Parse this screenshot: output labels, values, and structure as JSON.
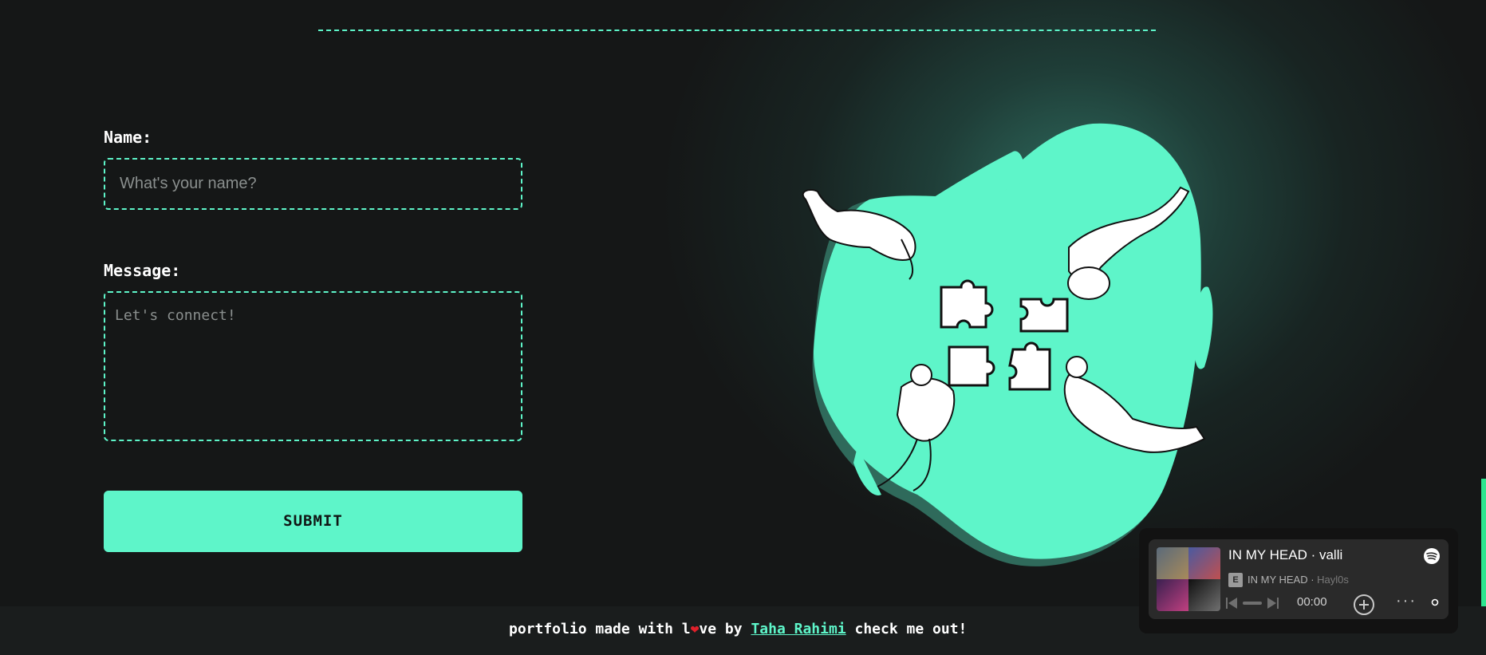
{
  "form": {
    "name_label": "Name:",
    "name_placeholder": "What's your name?",
    "message_label": "Message:",
    "message_placeholder": "Let's connect!",
    "submit_label": "SUBMIT"
  },
  "footer": {
    "text_before": "portfolio made with l",
    "heart": "❤",
    "text_after_heart": "ve by ",
    "author_link": "Taha Rahimi",
    "text_end": " check me out!"
  },
  "player": {
    "title": "IN MY HEAD · valli",
    "explicit_badge": "E",
    "album": "IN MY HEAD",
    "separator": " · ",
    "artist": "Hayl0s",
    "time": "00:00",
    "more": "···"
  },
  "colors": {
    "accent": "#5ef5c9",
    "background": "#151717",
    "heart": "#e0202a",
    "player_bg": "#2a2a2a",
    "spotify_green": "#ffffff"
  },
  "icons": [
    "spotify-icon",
    "previous-icon",
    "next-icon",
    "add-icon",
    "more-icon",
    "heart-icon"
  ]
}
